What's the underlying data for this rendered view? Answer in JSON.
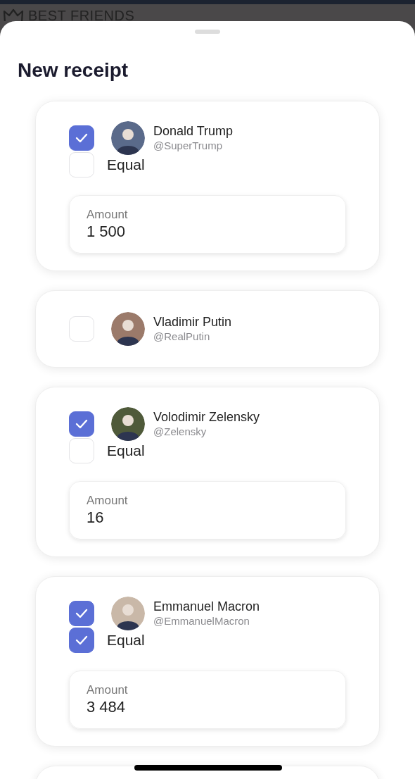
{
  "background_header": {
    "title": "BEST FRIENDS"
  },
  "sheet": {
    "title": "New receipt"
  },
  "members": [
    {
      "name": "Donald Trump",
      "handle": "@SuperTrump",
      "selected": true,
      "equal": {
        "label": "Equal",
        "checked": false
      },
      "amount": {
        "label": "Amount",
        "value": "1 500"
      }
    },
    {
      "name": "Vladimir Putin",
      "handle": "@RealPutin",
      "selected": false
    },
    {
      "name": "Volodimir Zelensky",
      "handle": "@Zelensky",
      "selected": true,
      "equal": {
        "label": "Equal",
        "checked": false
      },
      "amount": {
        "label": "Amount",
        "value": "16"
      }
    },
    {
      "name": "Emmanuel Macron",
      "handle": "@EmmanuelMacron",
      "selected": true,
      "equal": {
        "label": "Equal",
        "checked": true
      },
      "amount": {
        "label": "Amount",
        "value": "3 484"
      }
    }
  ]
}
